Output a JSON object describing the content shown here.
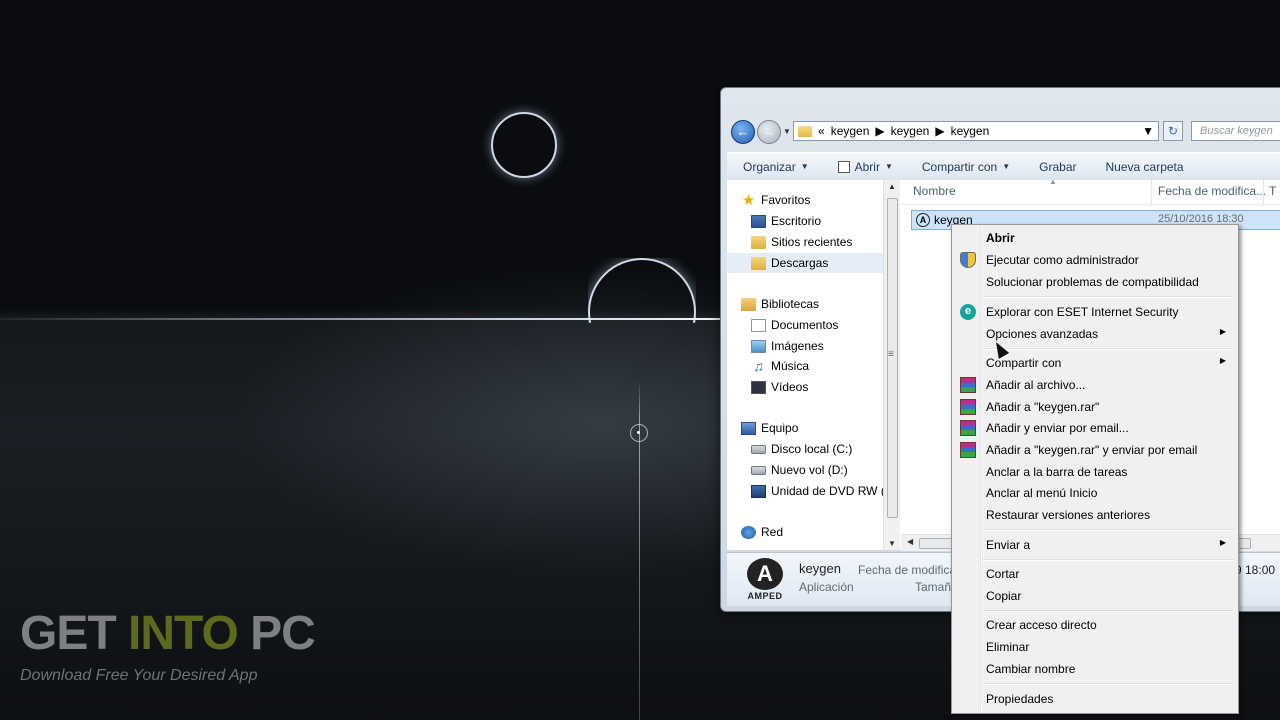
{
  "watermark": {
    "title_part1": "GET",
    "title_part2": "INTO",
    "title_part3": "PC",
    "subtitle": "Download Free Your Desired App"
  },
  "explorer": {
    "address": {
      "prefix": "«",
      "crumbs": [
        "keygen",
        "keygen",
        "keygen"
      ]
    },
    "search_placeholder": "Buscar keygen",
    "toolbar": {
      "organize": "Organizar",
      "open": "Abrir",
      "share": "Compartir con",
      "burn": "Grabar",
      "new_folder": "Nueva carpeta"
    },
    "nav": {
      "favorites": "Favoritos",
      "desktop": "Escritorio",
      "recent": "Sitios recientes",
      "downloads": "Descargas",
      "libraries": "Bibliotecas",
      "documents": "Documentos",
      "images": "Imágenes",
      "music": "Música",
      "videos": "Vídeos",
      "computer": "Equipo",
      "local_disk": "Disco local (C:)",
      "new_vol": "Nuevo vol (D:)",
      "dvd": "Unidad de DVD RW (E",
      "network": "Red"
    },
    "columns": {
      "name": "Nombre",
      "modified": "Fecha de modifica...",
      "type": "T"
    },
    "file": {
      "name": "keygen",
      "date": "25/10/2016 18:30"
    },
    "details": {
      "icon_text": "AMPED",
      "name": "keygen",
      "type": "Aplicación",
      "modified_label": "Fecha de modifica",
      "size_label": "Tamaño",
      "time_fragment": "9 18:00"
    }
  },
  "context_menu": {
    "open": "Abrir",
    "run_as_admin": "Ejecutar como administrador",
    "troubleshoot": "Solucionar problemas de compatibilidad",
    "eset_scan": "Explorar con ESET Internet Security",
    "advanced": "Opciones avanzadas",
    "share_with": "Compartir con",
    "add_archive": "Añadir al archivo...",
    "add_rar": "Añadir a \"keygen.rar\"",
    "add_email": "Añadir y enviar por email...",
    "add_rar_email": "Añadir a \"keygen.rar\" y enviar por email",
    "pin_taskbar": "Anclar a la barra de tareas",
    "pin_start": "Anclar al menú Inicio",
    "restore": "Restaurar versiones anteriores",
    "send_to": "Enviar a",
    "cut": "Cortar",
    "copy": "Copiar",
    "shortcut": "Crear acceso directo",
    "delete": "Eliminar",
    "rename": "Cambiar nombre",
    "properties": "Propiedades"
  }
}
